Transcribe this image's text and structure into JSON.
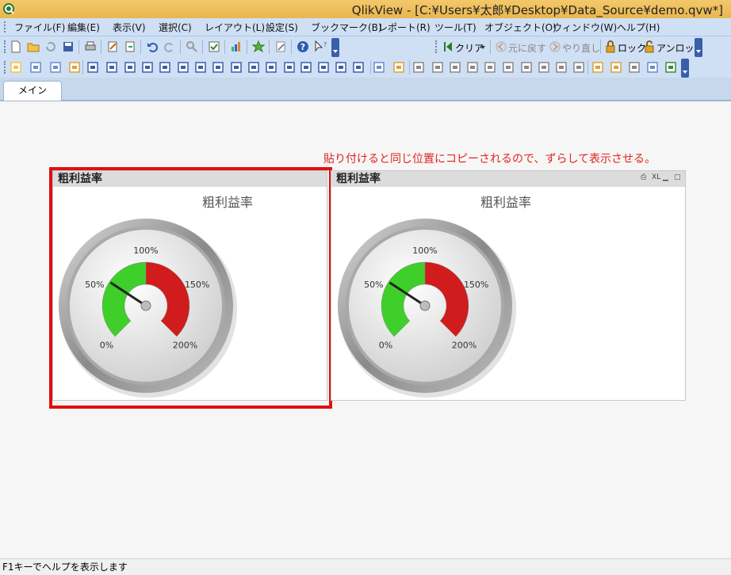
{
  "window": {
    "title": "QlikView - [C:¥Users¥太郎¥Desktop¥Data_Source¥demo.qvw*]"
  },
  "menu": [
    "ファイル(F)",
    "編集(E)",
    "表示(V)",
    "選択(C)",
    "レイアウト(L)",
    "設定(S)",
    "ブックマーク(B)",
    "レポート(R)",
    "ツール(T)",
    "オブジェクト(O)",
    "ウィンドウ(W)",
    "ヘルプ(H)"
  ],
  "toolbar1": {
    "clear_label": "クリア",
    "back_label": "元に戻す",
    "forward_label": "やり直し",
    "lock_label": "ロック",
    "unlock_label": "アンロック"
  },
  "tabs": [
    "メイン"
  ],
  "note": "貼り付けると同じ位置にコピーされるので、ずらして表示させる。",
  "objects": [
    {
      "caption": "粗利益率",
      "title": "粗利益率"
    },
    {
      "caption": "粗利益率",
      "title": "粗利益率",
      "xl_label": "XL"
    }
  ],
  "status": {
    "text": "F1キーでヘルプを表示します"
  },
  "chart_data": {
    "type": "gauge",
    "title": "粗利益率",
    "tick_labels": [
      "0%",
      "50%",
      "100%",
      "150%",
      "200%"
    ],
    "range": [
      0,
      200
    ],
    "segments": [
      {
        "from": 0,
        "to": 100,
        "color": "#3fcf2a"
      },
      {
        "from": 100,
        "to": 200,
        "color": "#d01c1c"
      }
    ],
    "value": 58
  }
}
